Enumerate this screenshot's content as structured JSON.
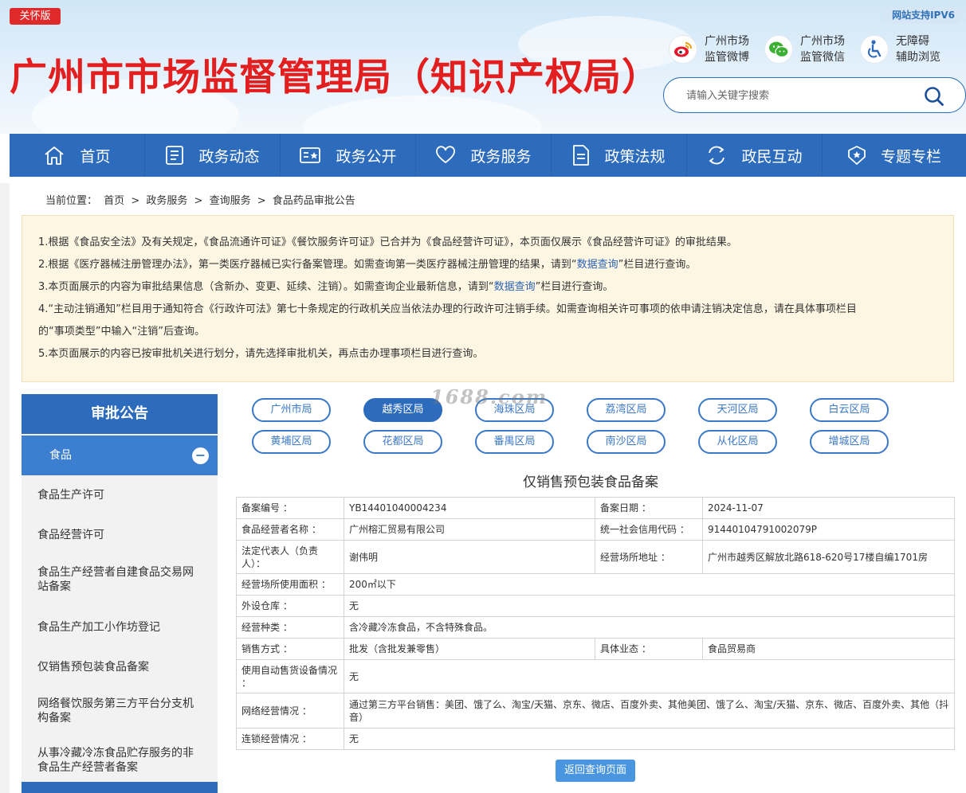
{
  "header": {
    "care_badge": "关怀版",
    "site_title": "广州市市场监督管理局（知识产权局）",
    "ipv6": "网站支持IPV6",
    "quick_links": [
      {
        "line1": "广州市场",
        "line2": "监管微博",
        "icon": "weibo-icon",
        "color": "#e6162d"
      },
      {
        "line1": "广州市场",
        "line2": "监管微信",
        "icon": "wechat-icon",
        "color": "#3cb034"
      },
      {
        "line1": "无障碍",
        "line2": "辅助浏览",
        "icon": "accessibility-icon",
        "color": "#2d6bbd"
      }
    ],
    "search_placeholder": "请输入关键字搜索"
  },
  "nav": [
    {
      "label": "首页",
      "icon": "home-icon"
    },
    {
      "label": "政务动态",
      "icon": "news-icon"
    },
    {
      "label": "政务公开",
      "icon": "open-govt-icon"
    },
    {
      "label": "政务服务",
      "icon": "heart-icon"
    },
    {
      "label": "政策法规",
      "icon": "document-icon"
    },
    {
      "label": "政民互动",
      "icon": "interaction-icon"
    },
    {
      "label": "专题专栏",
      "icon": "badge-icon"
    }
  ],
  "breadcrumb": {
    "prefix": "当前位置：",
    "items": [
      "首页",
      "政务服务",
      "查询服务",
      "食品药品审批公告"
    ],
    "separator": ">"
  },
  "notice": {
    "line1": "1.根据《食品安全法》及有关规定，《食品流通许可证》《餐饮服务许可证》已合并为《食品经营许可证》，本页面仅展示《食品经营许可证》的审批结果。",
    "line2_a": "2.根据《医疗器械注册管理办法》，第一类医疗器械已实行备案管理。如需查询第一类医疗器械注册管理的结果，请到“",
    "line2_link": "数据查询",
    "line2_b": "”栏目进行查询。",
    "line3_a": "3.本页面展示的内容为审批结果信息（含新办、变更、延续、注销）。如需查询企业最新信息，请到“",
    "line3_link": "数据查询",
    "line3_b": "”栏目进行查询。",
    "line4": "4.“主动注销通知”栏目用于通知符合《行政许可法》第七十条规定的行政机关应当依法办理的行政许可注销手续。如需查询相关许可事项的依申请注销决定信息，请在具体事项栏目",
    "line4b": "的“事项类型”中输入“注销”后查询。",
    "line5": "5.本页面展示的内容已按审批机关进行划分，请先选择审批机关，再点击办理事项栏目进行查询。"
  },
  "sidebar": {
    "title": "审批公告",
    "category": "食品",
    "items": [
      "食品生产许可",
      "食品经营许可",
      "食品生产经营者自建食品交易网站备案",
      "食品生产加工小作坊登记",
      "仅销售预包装食品备案",
      "网络餐饮服务第三方平台分支机构备案",
      "从事冷藏冷冻食品贮存服务的非食品生产经营者备案"
    ]
  },
  "watermark": "1688.com",
  "districts": [
    "广州市局",
    "越秀区局",
    "海珠区局",
    "荔湾区局",
    "天河区局",
    "白云区局",
    "黄埔区局",
    "花都区局",
    "番禺区局",
    "南沙区局",
    "从化区局",
    "增城区局"
  ],
  "active_district": "越秀区局",
  "record": {
    "title": "仅销售预包装食品备案",
    "filing_no_label": "备案编号 ：",
    "filing_no": "YB14401040004234",
    "filing_date_label": "备案日期 ：",
    "filing_date": "2024-11-07",
    "operator_label": "食品经营者名称 ：",
    "operator": "广州榕汇贸易有限公司",
    "credit_code_label": "统一社会信用代码 ：",
    "credit_code": "91440104791002079P",
    "legal_rep_label": "法定代表人（负责人）：",
    "legal_rep": "谢伟明",
    "address_label": "经营场所地址 ：",
    "address": "广州市越秀区解放北路618-620号17楼自编1701房",
    "area_label": "经营场所使用面积 ：",
    "area": "200㎡以下",
    "warehouse_label": "外设仓库 ：",
    "warehouse": "无",
    "category_label": "经营种类 ：",
    "category": "含冷藏冷冻食品，不含特殊食品。",
    "sales_label": "销售方式 ：",
    "sales": "批发（含批发兼零售）",
    "business_label": "具体业态 ：",
    "business": "食品贸易商",
    "vending_label": "使用自动售货设备情况 ：",
    "vending": "无",
    "online_label": "网络经营情况 ：",
    "online": "通过第三方平台销售：美团、饿了么、淘宝/天猫、京东、微店、百度外卖、其他美团、饿了么、淘宝/天猫、京东、微店、百度外卖、其他（抖音）",
    "chain_label": "连锁经营情况 ：",
    "chain": "无"
  },
  "back_button": "返回查询页面",
  "colors": {
    "primary": "#2d6bbd",
    "title_red": "#e21e1e",
    "notice_bg": "#fdf6e3"
  }
}
